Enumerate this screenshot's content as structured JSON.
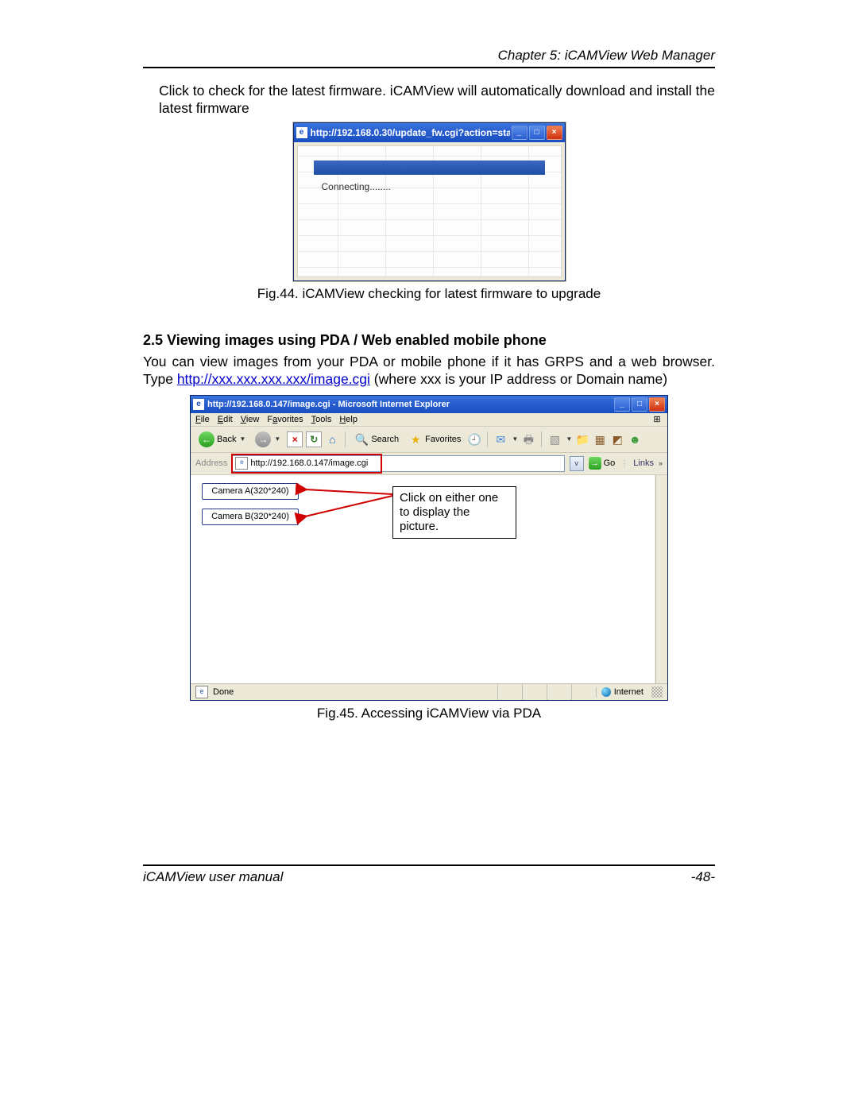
{
  "header": {
    "chapter": "Chapter 5: iCAMView Web Manager"
  },
  "intro1": "Click to check for the latest firmware.  iCAMView will automatically download and install the latest firmware",
  "win1": {
    "title": "http://192.168.0.30/update_fw.cgi?action=sta...",
    "status": "Connecting........",
    "btn_min": "_",
    "btn_max": "□",
    "btn_close": "×"
  },
  "caption1": "Fig.44.  iCAMView checking for latest firmware to upgrade",
  "section_title": "2.5 Viewing images using PDA / Web enabled mobile phone",
  "intro2a": "You can view images from your PDA or mobile phone if it has GRPS and a web browser.  Type ",
  "intro2_link": "http://xxx.xxx.xxx.xxx/image.cgi",
  "intro2b": " (where xxx is your IP address or Domain name)",
  "ie": {
    "title": "http://192.168.0.147/image.cgi - Microsoft Internet Explorer",
    "menus": {
      "file": "File",
      "edit": "Edit",
      "view": "View",
      "favorites": "Favorites",
      "tools": "Tools",
      "help": "Help"
    },
    "toolbar": {
      "back": "Back",
      "search": "Search",
      "favorites": "Favorites"
    },
    "addrbar": {
      "label": "Address",
      "url": "http://192.168.0.147/image.cgi",
      "go": "Go",
      "links": "Links"
    },
    "content": {
      "camA": "Camera A(320*240)",
      "camB": "Camera B(320*240)",
      "annotation": "Click on either one to display the picture."
    },
    "status": {
      "done": "Done",
      "internet": "Internet"
    }
  },
  "caption2": "Fig.45.  Accessing iCAMView via PDA",
  "footer": {
    "left": "iCAMView  user  manual",
    "right": "-48-"
  }
}
